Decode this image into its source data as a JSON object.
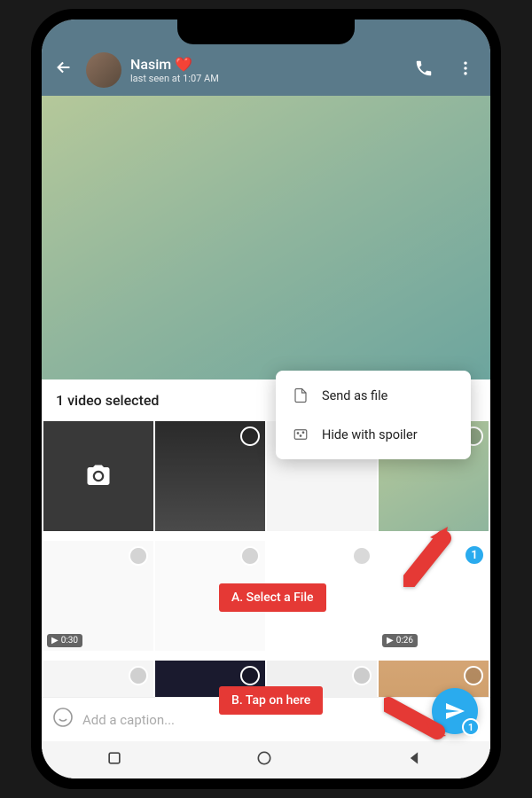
{
  "header": {
    "contact_name": "Nasim",
    "heart": "❤️",
    "last_seen": "last seen at 1:07 AM"
  },
  "sheet": {
    "title": "1 video selected"
  },
  "menu": {
    "send_as_file": "Send as file",
    "hide_spoiler": "Hide with spoiler"
  },
  "thumbs": {
    "dur1": "0:30",
    "dur2": "0:26",
    "sel_badge": "1"
  },
  "caption": {
    "placeholder": "Add a caption..."
  },
  "send": {
    "count": "1"
  },
  "callouts": {
    "a": "A. Select a File",
    "b": "B. Tap on here"
  }
}
